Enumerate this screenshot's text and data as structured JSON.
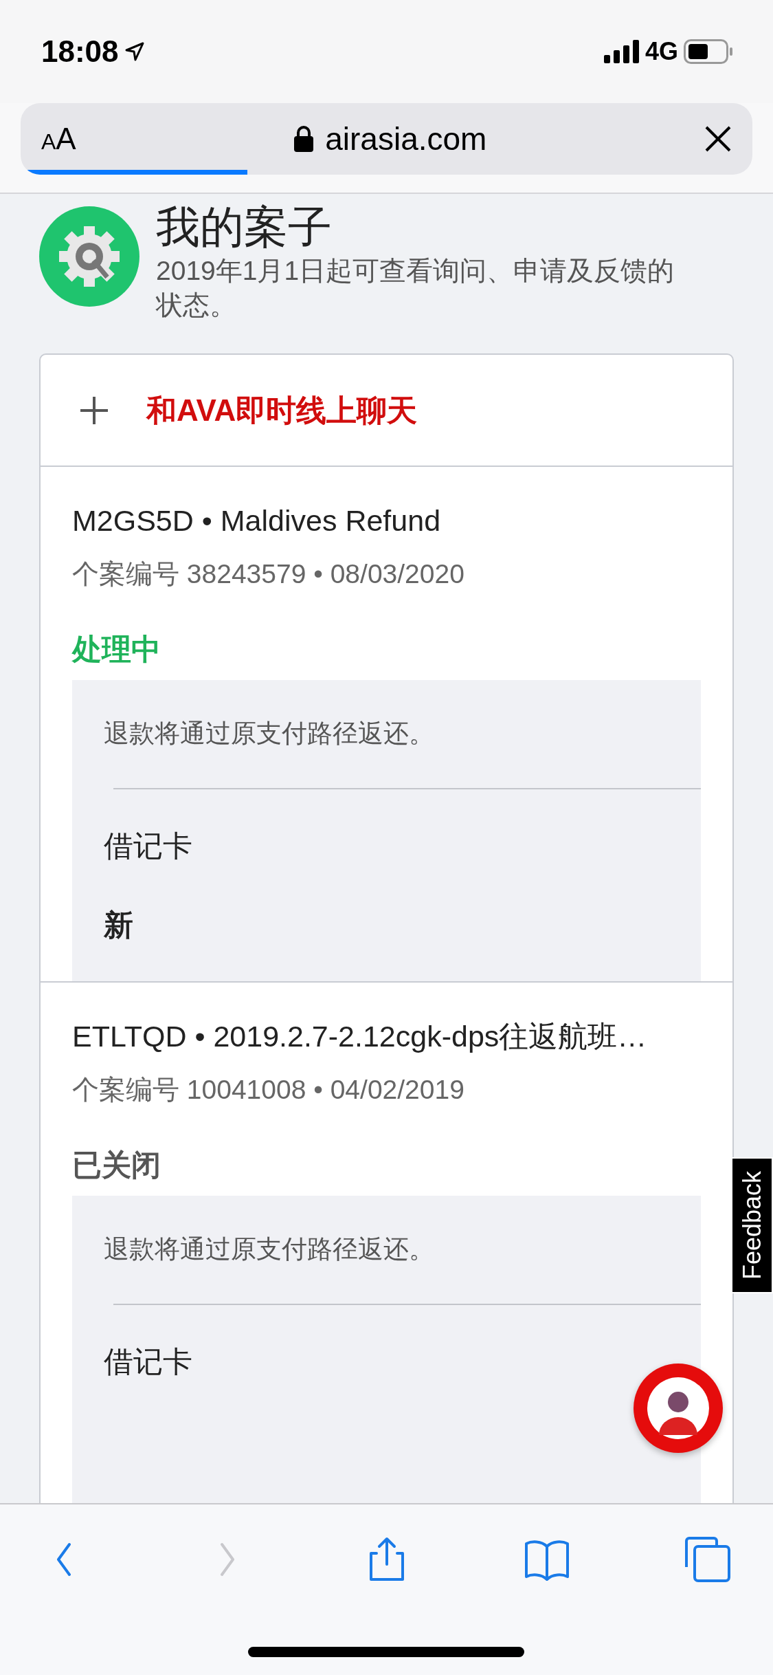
{
  "status_bar": {
    "time": "18:08",
    "network": "4G"
  },
  "browser": {
    "text_size_button": "AA",
    "url": "airasia.com",
    "load": {
      "level": 0.31
    }
  },
  "page": {
    "title": "我的案子",
    "subtitle": "2019年1月1日起可查看询问、申请及反馈的状态。",
    "chat_button": "和AVA即时线上聊天",
    "cases": [
      {
        "title": "M2GS5D • Maldives Refund",
        "meta": "个案编号 38243579 • 08/03/2020",
        "status": "处理中",
        "color": "#1fb35a",
        "note": "退款将通过原支付路径返还。",
        "method": "借记卡",
        "state": "新"
      },
      {
        "title": "ETLTQD • 2019.2.7-2.12cgk-dps往返航班…",
        "meta": "个案编号 10041008 • 04/02/2019",
        "status": "已关闭",
        "color": "#555555",
        "note": "退款将通过原支付路径返还。",
        "method": "借记卡"
      }
    ]
  },
  "feedback_tab": "Feedback",
  "toolbar": [
    {
      "kind": "back",
      "disabled": false
    },
    {
      "kind": "forward",
      "disabled": true
    },
    {
      "kind": "share",
      "disabled": false
    },
    {
      "kind": "bookmarks",
      "disabled": false
    },
    {
      "kind": "tabs",
      "disabled": false
    }
  ]
}
